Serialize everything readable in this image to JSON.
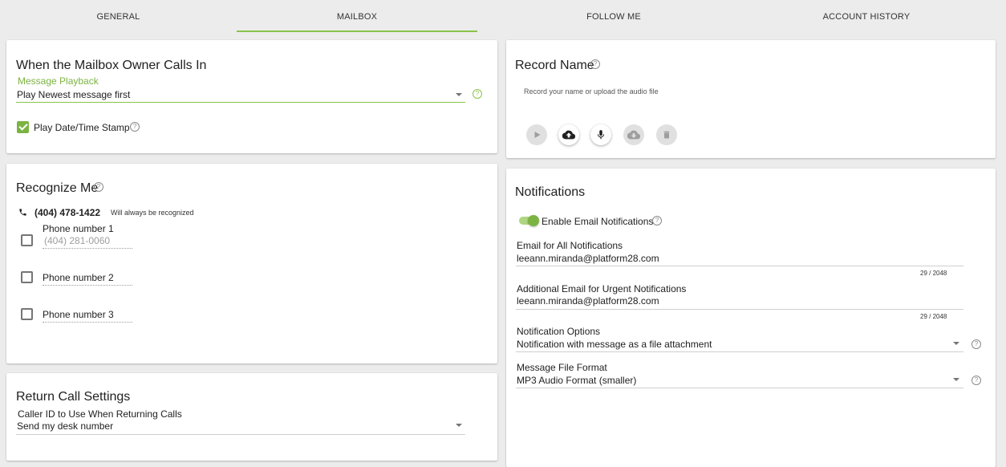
{
  "tabs": [
    {
      "label": "GENERAL"
    },
    {
      "label": "MAILBOX"
    },
    {
      "label": "FOLLOW ME"
    },
    {
      "label": "ACCOUNT HISTORY"
    }
  ],
  "active_tab": "MAILBOX",
  "owner_calls": {
    "title": "When the Mailbox Owner Calls In",
    "playback_label": "Message Playback",
    "playback_value": "Play Newest message first",
    "timestamp_label": "Play Date/Time Stamp",
    "timestamp_checked": true
  },
  "recognize": {
    "title": "Recognize Me",
    "primary_number": "(404) 478-1422",
    "primary_note": "Will always be recognized",
    "phones": [
      {
        "label": "Phone number 1",
        "value": "(404) 281-0060",
        "checked": false
      },
      {
        "label": "Phone number 2",
        "value": "",
        "checked": false
      },
      {
        "label": "Phone number 3",
        "value": "",
        "checked": false
      }
    ]
  },
  "return_call": {
    "title": "Return Call Settings",
    "caller_id_label": "Caller ID to Use When Returning Calls",
    "caller_id_value": "Send my desk number"
  },
  "record_name": {
    "title": "Record Name",
    "hint": "Record your name or upload the audio file",
    "buttons": [
      "play-icon",
      "cloud-upload-icon",
      "microphone-icon",
      "cloud-download-icon",
      "trash-icon"
    ]
  },
  "notifications": {
    "title": "Notifications",
    "enable_label": "Enable Email Notifications",
    "enable_on": true,
    "email_all_label": "Email for All Notifications",
    "email_all_value": "leeann.miranda@platform28.com",
    "email_all_counter": "29 / 2048",
    "email_urgent_label": "Additional Email for Urgent Notifications",
    "email_urgent_value": "leeann.miranda@platform28.com",
    "email_urgent_counter": "29 / 2048",
    "options_label": "Notification Options",
    "options_value": "Notification with message as a file attachment",
    "format_label": "Message File Format",
    "format_value": "MP3 Audio Format (smaller)"
  },
  "colors": {
    "accent": "#8bc34a",
    "accent_dark": "#7cb342",
    "background": "#ececec"
  }
}
